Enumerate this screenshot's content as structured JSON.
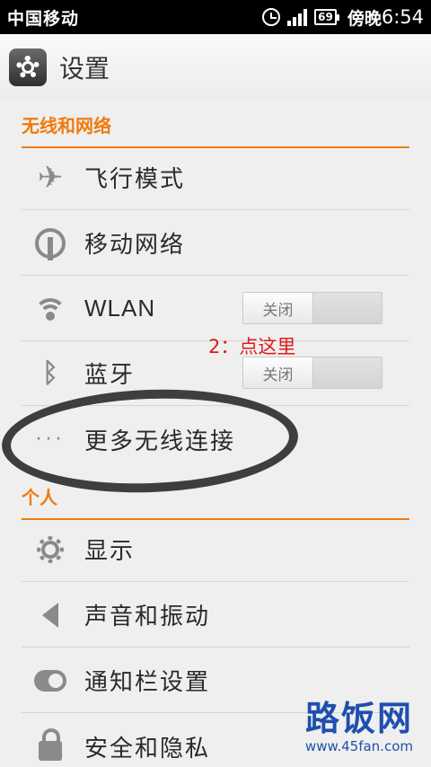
{
  "status_bar": {
    "carrier": "中国移动",
    "battery": "69",
    "period": "傍晚",
    "time": "6:54"
  },
  "header": {
    "title": "设置",
    "icon": "gear-icon"
  },
  "sections": {
    "wireless": "无线和网络",
    "personal": "个人"
  },
  "items": {
    "airplane": {
      "label": "飞行模式",
      "icon": "airplane-icon"
    },
    "mobile_network": {
      "label": "移动网络",
      "icon": "antenna-icon"
    },
    "wlan": {
      "label": "WLAN",
      "icon": "wifi-icon",
      "toggle": "关闭"
    },
    "bluetooth": {
      "label": "蓝牙",
      "icon": "bluetooth-icon",
      "toggle": "关闭"
    },
    "more_wireless": {
      "label": "更多无线连接",
      "icon": "more-dots-icon"
    },
    "display": {
      "label": "显示",
      "icon": "display-icon"
    },
    "sound": {
      "label": "声音和振动",
      "icon": "speaker-icon"
    },
    "notification": {
      "label": "通知栏设置",
      "icon": "toggle-icon"
    },
    "security": {
      "label": "安全和隐私",
      "icon": "lock-icon"
    }
  },
  "annotation": "2：点这里",
  "watermark": {
    "main": "路饭网",
    "sub": "www.45fan.com"
  },
  "colors": {
    "accent": "#f07a0f",
    "annotation": "#e01a1a",
    "watermark": "#1f4fae"
  }
}
